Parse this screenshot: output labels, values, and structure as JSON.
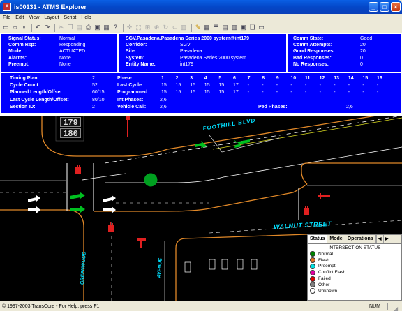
{
  "window": {
    "title": "is00131 - ATMS Explorer",
    "icon_text": "ATMS"
  },
  "menu": [
    "File",
    "Edit",
    "View",
    "Layout",
    "Script",
    "Help"
  ],
  "toolbar": [
    "new-icon",
    "open-icon",
    "save-icon",
    "undo-icon",
    "redo-icon",
    "cut-icon",
    "copy-icon",
    "paste-icon",
    "print-icon",
    "print-preview-icon",
    "properties-icon",
    "help-icon",
    "move-icon",
    "select-icon",
    "add-icon",
    "zoom-icon",
    "rotate-icon",
    "link-icon",
    "pencil-icon",
    "table-icon",
    "grid-icon",
    "list-icon",
    "tile-icon",
    "layout-icon",
    "window-icon"
  ],
  "status": {
    "rows": [
      {
        "label": "Signal Status:",
        "value": "Normal"
      },
      {
        "label": "Comm Rsp:",
        "value": "Responding"
      },
      {
        "label": "Mode:",
        "value": "ACTUATED"
      },
      {
        "label": "Alarms:",
        "value": "None"
      },
      {
        "label": "Preempt:",
        "value": "None"
      }
    ]
  },
  "corridor": {
    "header": "SGV.Pasadena.Pasadena Series 2000 system@int179",
    "rows": [
      {
        "label": "Corridor:",
        "value": "SGV"
      },
      {
        "label": "Site:",
        "value": "Pasadena"
      },
      {
        "label": "System:",
        "value": "Pasadena Series 2000 system"
      },
      {
        "label": "Entity Name:",
        "value": "int179"
      }
    ]
  },
  "comm": {
    "rows": [
      {
        "label": "Comm State:",
        "value": "Good"
      },
      {
        "label": "Comm Attempts:",
        "value": "20"
      },
      {
        "label": "Good Responses:",
        "value": "20"
      },
      {
        "label": "Bad Responses:",
        "value": "0"
      },
      {
        "label": "No Responses:",
        "value": "0"
      }
    ]
  },
  "timing": {
    "left": [
      {
        "label": "Timing Plan:",
        "value": "2"
      },
      {
        "label": "Cycle Count:",
        "value": "52"
      },
      {
        "label": "Planned Length/Offset:",
        "value": "60/15"
      },
      {
        "label": "Last Cycle Length/Offset:",
        "value": "80/10"
      },
      {
        "label": "Section ID:",
        "value": "2"
      }
    ],
    "phase_label": "Phase:",
    "phases": [
      "1",
      "2",
      "3",
      "4",
      "5",
      "6",
      "7",
      "8",
      "9",
      "10",
      "11",
      "12",
      "13",
      "14",
      "15",
      "16"
    ],
    "last_cycle_label": "Last Cycle:",
    "last_cycle": [
      "15",
      "15",
      "15",
      "15",
      "15",
      "17",
      "-",
      "-",
      "-",
      "-",
      "-",
      "-",
      "-",
      "-",
      "-",
      "-"
    ],
    "programmed_label": "Programmed:",
    "programmed": [
      "15",
      "15",
      "15",
      "15",
      "15",
      "17",
      "-",
      "-",
      "-",
      "-",
      "-",
      "-",
      "-",
      "-",
      "-",
      "-"
    ],
    "int_phases_label": "Int Phases:",
    "int_phases": "2,6",
    "vehicle_call_label": "Vehicle Call:",
    "vehicle_call": "2,6",
    "ped_phases_label": "Ped Phases:",
    "ped_phases": "2,6"
  },
  "map": {
    "counter_top": "179",
    "counter_bottom": "180",
    "streets": {
      "foothill": "FOOTHILL BLVD",
      "walnut": "WALNUT STREET",
      "greenwood": "GREENWOOD",
      "avenue": "AVENUE"
    }
  },
  "legend": {
    "tabs": [
      "Status",
      "Mode",
      "Operations"
    ],
    "header": "INTERSECTION STATUS",
    "items": [
      {
        "label": "Normal",
        "color": "#008000"
      },
      {
        "label": "Flash",
        "color": "#e07020"
      },
      {
        "label": "Preempt",
        "color": "#00e0e0"
      },
      {
        "label": "Conflict Flash",
        "color": "#e000a0"
      },
      {
        "label": "Failed",
        "color": "#e00000"
      },
      {
        "label": "Other",
        "color": "#808080"
      },
      {
        "label": "Unknown",
        "color": "#ffffff"
      }
    ]
  },
  "statusbar": {
    "message": "© 1997-2003 TransCore - For Help, press F1",
    "num": "NUM"
  }
}
